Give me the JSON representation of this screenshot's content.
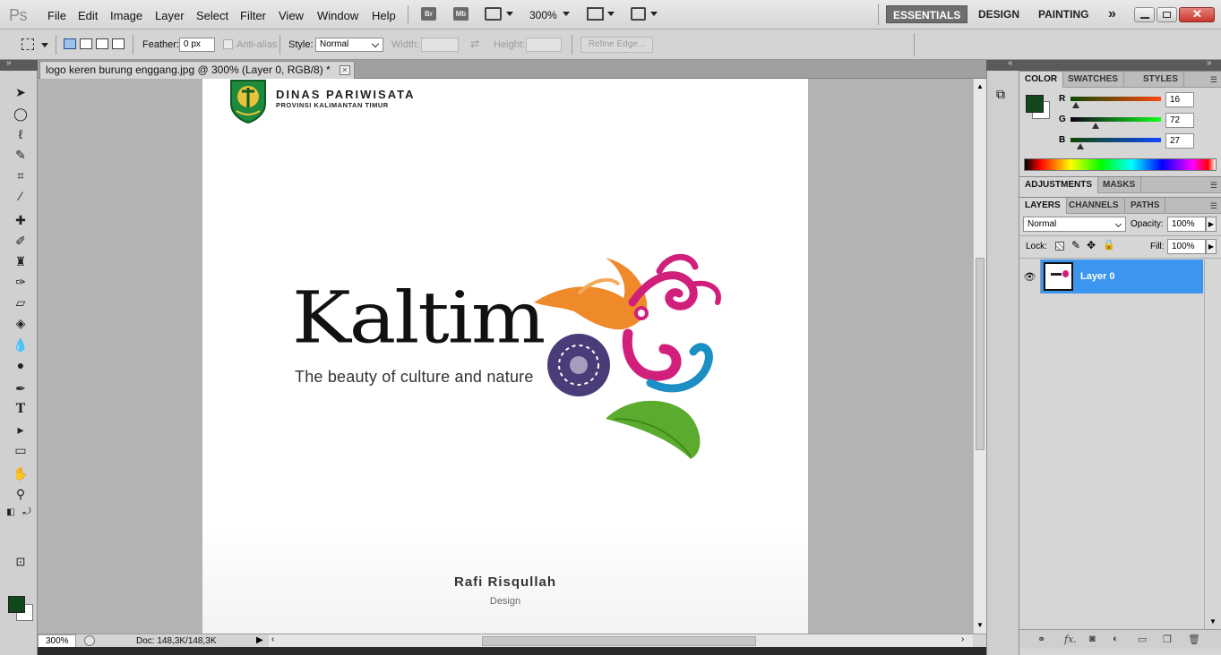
{
  "app": {
    "logo": "Ps"
  },
  "menu": [
    "File",
    "Edit",
    "Image",
    "Layer",
    "Select",
    "Filter",
    "View",
    "Window",
    "Help"
  ],
  "appbar": {
    "bridge": "Br",
    "minibridge": "Mb",
    "zoom": "300%"
  },
  "workspaces": {
    "essentials": "ESSENTIALS",
    "design": "DESIGN",
    "painting": "PAINTING",
    "more": "»"
  },
  "options": {
    "feather_label": "Feather:",
    "feather_value": "0 px",
    "antialias_label": "Anti-alias",
    "style_label": "Style:",
    "style_value": "Normal",
    "width_label": "Width:",
    "height_label": "Height:",
    "refine_edge": "Refine Edge..."
  },
  "document": {
    "tab_title": "logo keren burung enggang.jpg @ 300% (Layer 0, RGB/8) *",
    "close_glyph": "×"
  },
  "canvas": {
    "dinas_title": "DINAS  PARIWISATA",
    "dinas_subtitle": "PROVINSI KALIMANTAN TIMUR",
    "brand_word": "Kaltim",
    "tagline": "The beauty of culture and nature",
    "author_name": "Rafi Risqullah",
    "author_role": "Design"
  },
  "status": {
    "zoom": "300%",
    "doc_info": "Doc: 148,3K/148,3K"
  },
  "color_panel": {
    "tabs": [
      "COLOR",
      "SWATCHES",
      "STYLES"
    ],
    "r_label": "R",
    "g_label": "G",
    "b_label": "B",
    "r": "16",
    "g": "72",
    "b": "27",
    "r_fraction": 0.063,
    "g_fraction": 0.282,
    "b_fraction": 0.106,
    "foreground": "#10481b",
    "background": "#ffffff"
  },
  "adjustments_panel": {
    "tabs": [
      "ADJUSTMENTS",
      "MASKS"
    ]
  },
  "layers_panel": {
    "tabs": [
      "LAYERS",
      "CHANNELS",
      "PATHS"
    ],
    "blend_mode": "Normal",
    "opacity_label": "Opacity:",
    "opacity": "100%",
    "lock_label": "Lock:",
    "fill_label": "Fill:",
    "fill": "100%",
    "layers": [
      {
        "name": "Layer 0",
        "visible": true,
        "selected": true
      }
    ]
  },
  "colors": {
    "selection": "#3c96f0",
    "ui_gray": "#d4d4d4"
  }
}
